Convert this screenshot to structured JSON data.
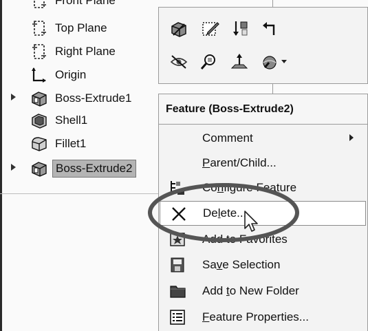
{
  "tree": {
    "items": [
      {
        "label": "Front Plane",
        "icon": "plane-icon"
      },
      {
        "label": "Top Plane",
        "icon": "plane-icon"
      },
      {
        "label": "Right Plane",
        "icon": "plane-icon"
      },
      {
        "label": "Origin",
        "icon": "origin-icon"
      },
      {
        "label": "Boss-Extrude1",
        "icon": "boss-extrude-icon",
        "expandable": true
      },
      {
        "label": "Shell1",
        "icon": "shell-icon"
      },
      {
        "label": "Fillet1",
        "icon": "fillet-icon"
      },
      {
        "label": "Boss-Extrude2",
        "icon": "boss-extrude-icon",
        "expandable": true,
        "selected": true
      }
    ]
  },
  "toolbar": {
    "row1": [
      "edit-feature-icon",
      "edit-sketch-icon",
      "rollback-icon",
      "back-arrow-icon"
    ],
    "row2": [
      "hide-icon",
      "zoom-to-selection-icon",
      "normal-to-icon",
      "appearance-icon"
    ]
  },
  "context_menu": {
    "title": "Feature (Boss-Extrude2)",
    "items": [
      {
        "pre": "Comment",
        "mnemonic": "",
        "post": "",
        "icon": "",
        "submenu": true
      },
      {
        "pre": "",
        "mnemonic": "P",
        "post": "arent/Child...",
        "icon": ""
      },
      {
        "pre": "Co",
        "mnemonic": "n",
        "post": "figure Feature",
        "icon": "configure-feature-icon"
      },
      {
        "pre": "De",
        "mnemonic": "l",
        "post": "ete...",
        "icon": "delete-icon",
        "hover": true
      },
      {
        "pre": "Add to Favorites",
        "mnemonic": "",
        "post": "",
        "icon": "favorites-icon"
      },
      {
        "pre": "Sa",
        "mnemonic": "v",
        "post": "e Selection",
        "icon": "save-selection-icon"
      },
      {
        "pre": "Add ",
        "mnemonic": "t",
        "post": "o New Folder",
        "icon": "folder-icon"
      },
      {
        "pre": "",
        "mnemonic": "F",
        "post": "eature Properties...",
        "icon": "properties-icon"
      }
    ]
  },
  "colors": {
    "selection_highlight": "#b4b4b4",
    "menu_background": "#f3f3f3",
    "annotation_ellipse": "#555555"
  }
}
